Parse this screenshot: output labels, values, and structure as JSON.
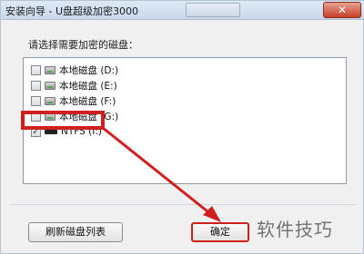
{
  "window": {
    "title": "安装向导 - U盘超级加密3000",
    "close_symbol": "✕"
  },
  "prompt": "请选择需要加密的磁盘：",
  "drives": [
    {
      "label": "本地磁盘 (D:)",
      "checked": false,
      "icon": "hard-drive-icon"
    },
    {
      "label": "本地磁盘 (E:)",
      "checked": false,
      "icon": "hard-drive-icon"
    },
    {
      "label": "本地磁盘 (F:)",
      "checked": false,
      "icon": "hard-drive-icon"
    },
    {
      "label": "本地磁盘 (G:)",
      "checked": false,
      "icon": "hard-drive-icon"
    },
    {
      "label": "NTFS (I:)",
      "checked": true,
      "icon": "usb-drive-icon"
    }
  ],
  "buttons": {
    "refresh": "刷新磁盘列表",
    "ok": "确定"
  },
  "colors": {
    "highlight": "#d11f1f",
    "arrow": "#d11f1f"
  },
  "watermark": "软件技巧"
}
